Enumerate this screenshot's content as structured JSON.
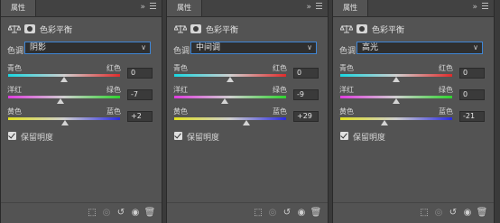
{
  "panels": [
    {
      "tab": "属性",
      "title": "色彩平衡",
      "tone_label": "色调:",
      "tone_value": "阴影",
      "sliders": [
        {
          "left": "青色",
          "right": "红色",
          "value": "0",
          "level": 0,
          "colors": [
            "#19d6e0",
            "#e02b2b"
          ]
        },
        {
          "left": "洋红",
          "right": "绿色",
          "value": "-7",
          "level": -7,
          "colors": [
            "#e03ce0",
            "#2ed42e"
          ]
        },
        {
          "left": "黄色",
          "right": "蓝色",
          "value": "+2",
          "level": 2,
          "colors": [
            "#e0e020",
            "#2a2ae0"
          ]
        }
      ],
      "preserve": "保留明度"
    },
    {
      "tab": "属性",
      "title": "色彩平衡",
      "tone_label": "色调:",
      "tone_value": "中间调",
      "sliders": [
        {
          "left": "青色",
          "right": "红色",
          "value": "0",
          "level": 0,
          "colors": [
            "#19d6e0",
            "#e02b2b"
          ]
        },
        {
          "left": "洋红",
          "right": "绿色",
          "value": "-9",
          "level": -9,
          "colors": [
            "#e03ce0",
            "#2ed42e"
          ]
        },
        {
          "left": "黄色",
          "right": "蓝色",
          "value": "+29",
          "level": 29,
          "colors": [
            "#e0e020",
            "#2a2ae0"
          ]
        }
      ],
      "preserve": "保留明度"
    },
    {
      "tab": "属性",
      "title": "色彩平衡",
      "tone_label": "色调:",
      "tone_value": "高光",
      "sliders": [
        {
          "left": "青色",
          "right": "红色",
          "value": "0",
          "level": 0,
          "colors": [
            "#19d6e0",
            "#e02b2b"
          ]
        },
        {
          "left": "洋红",
          "right": "绿色",
          "value": "0",
          "level": 0,
          "colors": [
            "#e03ce0",
            "#2ed42e"
          ]
        },
        {
          "left": "黄色",
          "right": "蓝色",
          "value": "-21",
          "level": -21,
          "colors": [
            "#e0e020",
            "#2a2ae0"
          ]
        }
      ],
      "preserve": "保留明度"
    }
  ],
  "slider_range": [
    -100,
    100
  ],
  "bottom_icons": [
    "clip-to-layer-icon",
    "view-previous-icon",
    "reset-icon",
    "visibility-eye-icon",
    "trash-icon"
  ]
}
